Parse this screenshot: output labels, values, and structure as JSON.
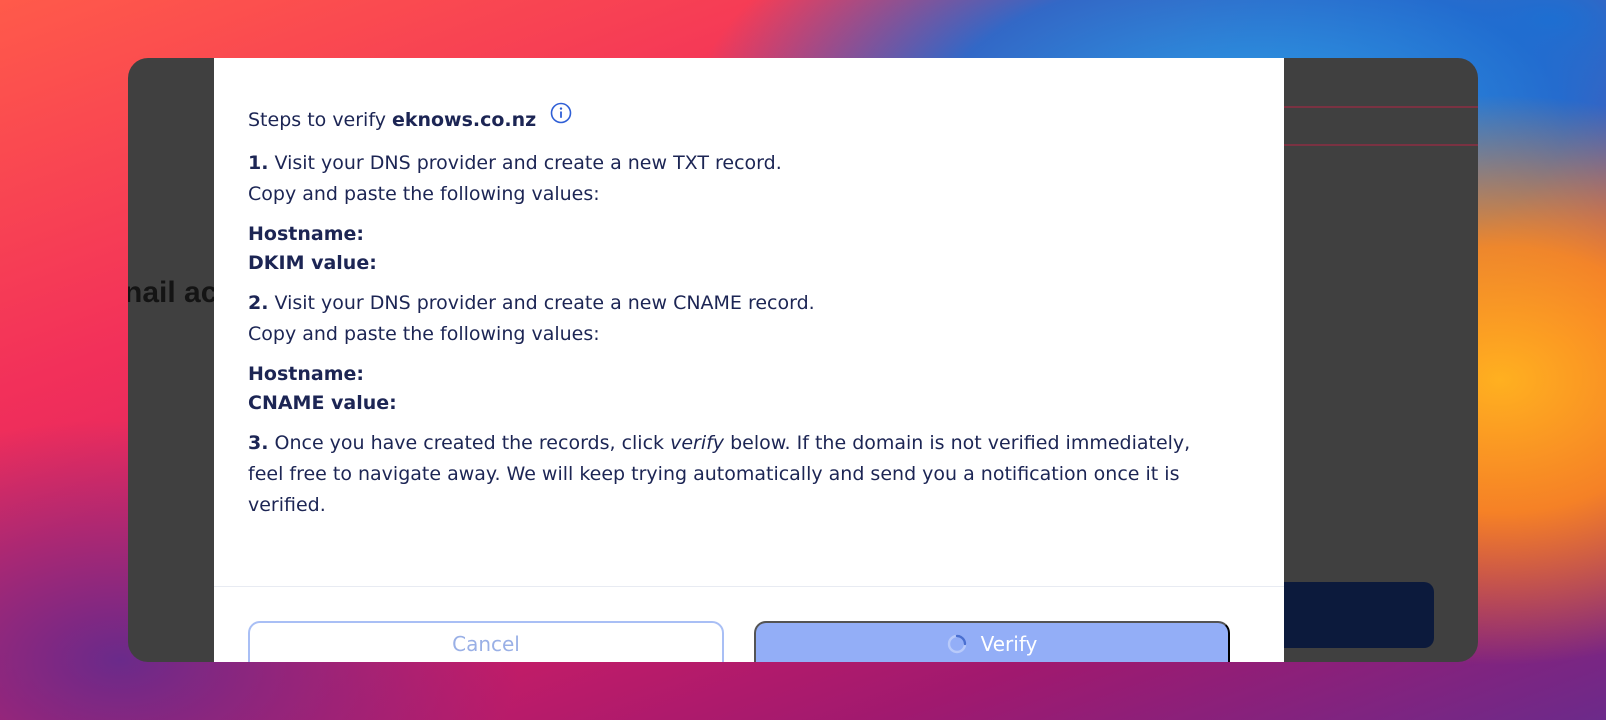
{
  "background_page": {
    "heading_fragment": "nail ac"
  },
  "modal": {
    "title_prefix": "Steps to verify",
    "domain": "eknows.co.nz",
    "info_icon": "info-circle-icon",
    "step1": {
      "number": "1.",
      "text": "Visit your DNS provider and create a new TXT record.",
      "copy_text": "Copy and paste the following values:",
      "hostname_label": "Hostname:",
      "value_label": "DKIM value:"
    },
    "step2": {
      "number": "2.",
      "text": "Visit your DNS provider and create a new CNAME record.",
      "copy_text": "Copy and paste the following values:",
      "hostname_label": "Hostname:",
      "value_label": "CNAME value:"
    },
    "step3": {
      "number": "3.",
      "text_before": "Once you have created the records, click",
      "emphasis": "verify",
      "text_after": "below. If the domain is not verified immediately, feel free to navigate away. We will keep trying automatically and send you a notification once it is verified."
    },
    "buttons": {
      "cancel_label": "Cancel",
      "verify_label": "Verify",
      "verify_icon": "loading-spinner-icon"
    }
  },
  "colors": {
    "text": "#1c2554",
    "verify_button": "#93aef7",
    "cancel_border": "#a9bff5"
  }
}
